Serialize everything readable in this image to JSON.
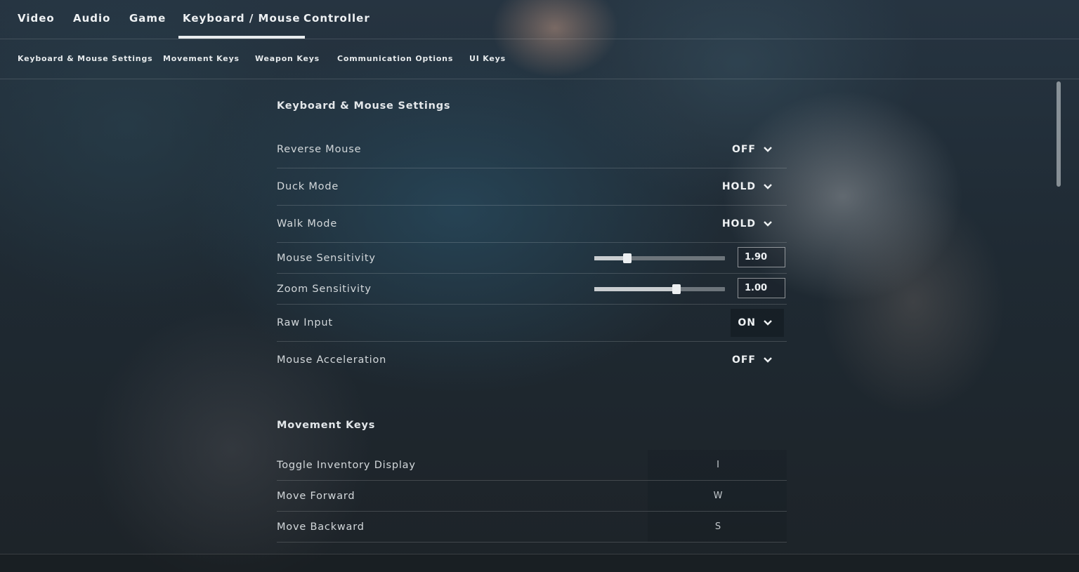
{
  "top_tabs": [
    {
      "label": "Video"
    },
    {
      "label": "Audio"
    },
    {
      "label": "Game"
    },
    {
      "label": "Keyboard / Mouse",
      "active": true
    },
    {
      "label": "Controller"
    }
  ],
  "sub_tabs": [
    {
      "label": "Keyboard & Mouse Settings"
    },
    {
      "label": "Movement Keys"
    },
    {
      "label": "Weapon Keys"
    },
    {
      "label": "Communication Options"
    },
    {
      "label": "UI Keys"
    }
  ],
  "keyboard_mouse_section": {
    "title": "Keyboard & Mouse Settings",
    "reverse_mouse": {
      "label": "Reverse Mouse",
      "value": "OFF"
    },
    "duck_mode": {
      "label": "Duck Mode",
      "value": "HOLD"
    },
    "walk_mode": {
      "label": "Walk Mode",
      "value": "HOLD"
    },
    "mouse_sensitivity": {
      "label": "Mouse Sensitivity",
      "value": "1.90",
      "slider_fraction": 0.25
    },
    "zoom_sensitivity": {
      "label": "Zoom Sensitivity",
      "value": "1.00",
      "slider_fraction": 0.63
    },
    "raw_input": {
      "label": "Raw Input",
      "value": "ON"
    },
    "mouse_acceleration": {
      "label": "Mouse Acceleration",
      "value": "OFF"
    }
  },
  "movement_keys_section": {
    "title": "Movement Keys",
    "toggle_inventory": {
      "label": "Toggle Inventory Display",
      "key": "I"
    },
    "move_forward": {
      "label": "Move Forward",
      "key": "W"
    },
    "move_backward": {
      "label": "Move Backward",
      "key": "S"
    }
  },
  "icons": {
    "dropdown": "chevron-down-icon"
  }
}
